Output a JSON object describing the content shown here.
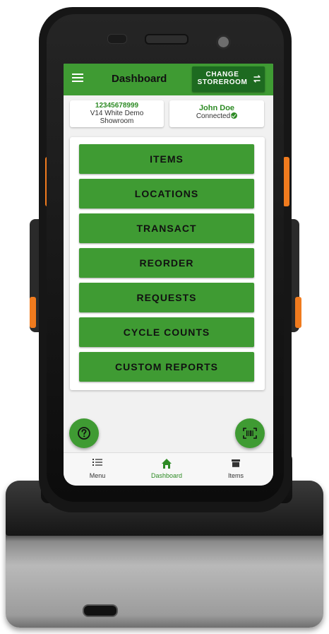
{
  "app_bar": {
    "title": "Dashboard",
    "change_storeroom_line1": "CHANGE",
    "change_storeroom_line2": "STOREROOM",
    "menu_icon": "hamburger-icon",
    "swap_icon": "swap-arrows-icon"
  },
  "storeroom_card": {
    "id": "12345678999",
    "name_line1": "V14 White Demo",
    "name_line2": "Showroom"
  },
  "user_card": {
    "name": "John Doe",
    "status": "Connected",
    "status_icon": "check-circle-icon"
  },
  "menu": {
    "buttons": [
      "ITEMS",
      "LOCATIONS",
      "TRANSACT",
      "REORDER",
      "REQUESTS",
      "CYCLE COUNTS",
      "CUSTOM REPORTS"
    ]
  },
  "fabs": {
    "help_icon": "question-icon",
    "scan_icon": "barcode-scan-icon"
  },
  "bottom_nav": {
    "items": [
      {
        "label": "Menu",
        "icon": "list-icon",
        "active": false
      },
      {
        "label": "Dashboard",
        "icon": "home-icon",
        "active": true
      },
      {
        "label": "Items",
        "icon": "box-icon",
        "active": false
      }
    ]
  },
  "colors": {
    "primary": "#3f9b33",
    "primary_dark": "#1d6a20",
    "accent_text": "#2e8b25",
    "hardware_accent": "#f07b1e"
  }
}
